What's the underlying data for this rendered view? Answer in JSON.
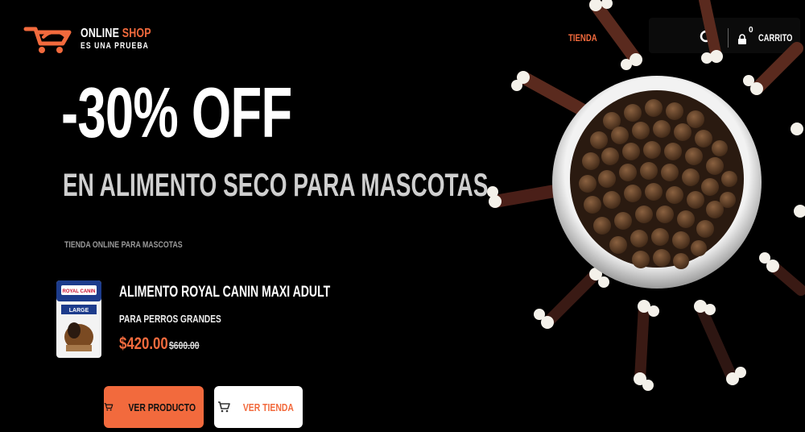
{
  "header": {
    "logo": {
      "line1_a": "ONLINE",
      "line1_b": "SHOP",
      "line2": "ES UNA PRUEBA"
    },
    "nav": {
      "tienda_label": "TIENDA"
    },
    "cart": {
      "count": "0",
      "label": "CARRITO"
    }
  },
  "hero": {
    "headline": "-30% OFF",
    "subheadline": "EN ALIMENTO SECO PARA MASCOTAS",
    "tagline": "TIENDA ONLINE PARA MASCOTAS"
  },
  "product": {
    "name": "ALIMENTO ROYAL CANIN MAXI ADULT",
    "subtitle": "PARA PERROS GRANDES",
    "price": "$420.00",
    "old_price": "$600.00",
    "package_brand": "ROYAL CANIN",
    "package_size": "LARGE"
  },
  "buttons": {
    "primary_label": "VER PRODUCTO",
    "secondary_label": "VER TIENDA"
  },
  "colors": {
    "accent": "#f26a3d",
    "background": "#000000"
  },
  "icons": [
    "logo-icon",
    "chevron-down-icon",
    "search-icon",
    "lock-icon",
    "cart-icon"
  ]
}
